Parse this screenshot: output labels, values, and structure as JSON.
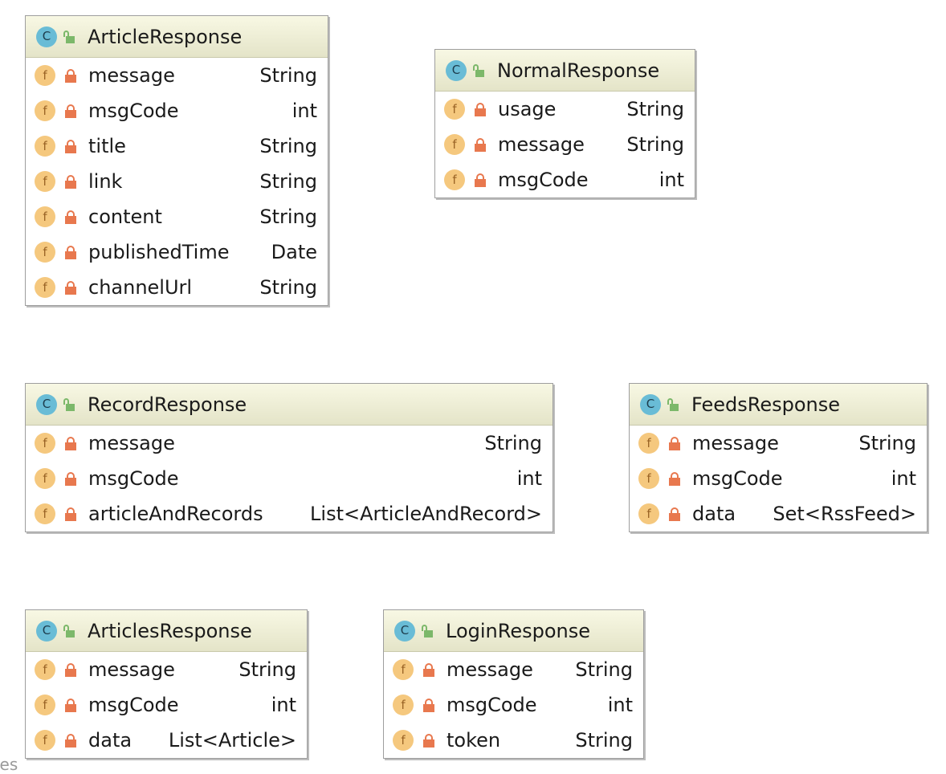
{
  "classes": [
    {
      "name": "ArticleResponse",
      "fields": [
        {
          "name": "message",
          "type": "String"
        },
        {
          "name": "msgCode",
          "type": "int"
        },
        {
          "name": "title",
          "type": "String"
        },
        {
          "name": "link",
          "type": "String"
        },
        {
          "name": "content",
          "type": "String"
        },
        {
          "name": "publishedTime",
          "type": "Date"
        },
        {
          "name": "channelUrl",
          "type": "String"
        }
      ]
    },
    {
      "name": "NormalResponse",
      "fields": [
        {
          "name": "usage",
          "type": "String"
        },
        {
          "name": "message",
          "type": "String"
        },
        {
          "name": "msgCode",
          "type": "int"
        }
      ]
    },
    {
      "name": "RecordResponse",
      "fields": [
        {
          "name": "message",
          "type": "String"
        },
        {
          "name": "msgCode",
          "type": "int"
        },
        {
          "name": "articleAndRecords",
          "type": "List<ArticleAndRecord>"
        }
      ]
    },
    {
      "name": "FeedsResponse",
      "fields": [
        {
          "name": "message",
          "type": "String"
        },
        {
          "name": "msgCode",
          "type": "int"
        },
        {
          "name": "data",
          "type": "Set<RssFeed>"
        }
      ]
    },
    {
      "name": "ArticlesResponse",
      "fields": [
        {
          "name": "message",
          "type": "String"
        },
        {
          "name": "msgCode",
          "type": "int"
        },
        {
          "name": "data",
          "type": "List<Article>"
        }
      ]
    },
    {
      "name": "LoginResponse",
      "fields": [
        {
          "name": "message",
          "type": "String"
        },
        {
          "name": "msgCode",
          "type": "int"
        },
        {
          "name": "token",
          "type": "String"
        }
      ]
    }
  ],
  "icons": {
    "class_badge": "C",
    "field_badge": "f",
    "class_visibility": "unlock-icon",
    "field_visibility": "lock-icon"
  },
  "footer_text": "les",
  "colors": {
    "class_badge": "#69bcd6",
    "field_badge": "#f5c87e",
    "public_lock": "#7cb86a",
    "private_lock": "#e8784e",
    "header_gradient_top": "#f8f8e4",
    "header_gradient_bottom": "#e4e4c8"
  }
}
